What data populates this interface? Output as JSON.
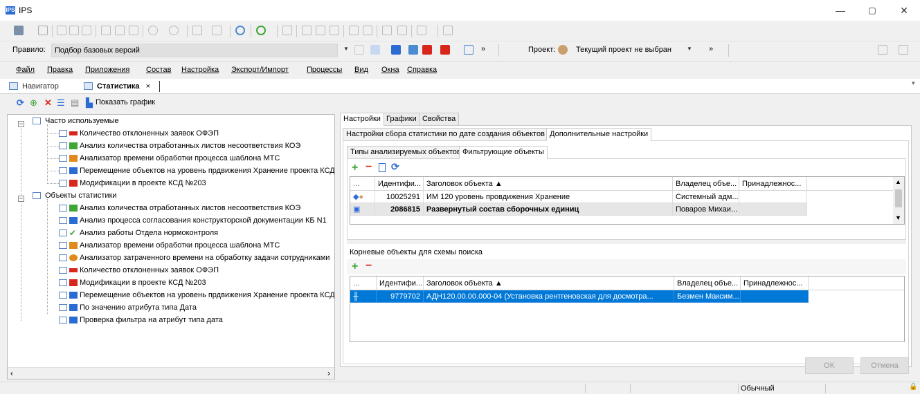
{
  "window": {
    "title": "IPS",
    "app_icon": "IPS",
    "minimize": "—",
    "maximize": "▢",
    "close": "✕"
  },
  "toolbar2": {
    "rule_label": "Правило:",
    "rule_value": "Подбор базовых версий",
    "project_label": "Проект:",
    "project_value": "Текущий проект не выбран"
  },
  "menu": [
    "Файл",
    "Правка",
    "Приложения",
    "Состав",
    "Настройка",
    "Экспорт/Импорт",
    "Процессы",
    "Вид",
    "Окна",
    "Справка"
  ],
  "doc_tabs": {
    "navigator": "Навигатор",
    "statistics": "Статистика",
    "close": "×"
  },
  "graph_toolbar": {
    "show_chart": "Показать график"
  },
  "tree": {
    "group1": "Часто используемые",
    "group1_items": [
      "Количество отклоненных заявок ОФЭП",
      "Анализ количества отработанных листов несоответствия КОЭ",
      "Анализатор времени обработки процесса шаблона МТС",
      "Перемещение объектов  на уровень прдвижения Хранение  проекта  КСД №203",
      "Модификации в проекте КСД №203"
    ],
    "group2": "Объекты статистики",
    "group2_items": [
      "Анализ количества отработанных листов несоответствия КОЭ",
      "Анализ процесса согласования конструкторской документации КБ N1",
      "Анализ работы Отдела нормоконтроля",
      "Анализатор времени обработки процесса шаблона МТС",
      "Анализатор затраченного времени на обработку задачи сотрудниками",
      "Количество отклоненных заявок ОФЭП",
      "Модификации в проекте КСД №203",
      "Перемещение объектов  на уровень прдвижения Хранение  проекта  КСД №203",
      "По значению атрибута типа Дата",
      "Проверка фильтра на атрибут типа дата"
    ]
  },
  "right": {
    "tabs_top": [
      "Настройки",
      "Графики",
      "Свойства"
    ],
    "tabs_mid": [
      "Настройки сбора статистики по дате создания объектов",
      "Дополнительные настройки"
    ],
    "tabs_inner": [
      "Типы анализируемых объектов",
      "Фильтрующие объекты"
    ],
    "grid1": {
      "headers": [
        "...",
        "Идентифи...",
        "Заголовок объекта ▲",
        "Владелец объе...",
        "Принадлежнос..."
      ],
      "rows": [
        {
          "id": "10025291",
          "title": "ИМ 120 уровень провдижения Хранение",
          "owner": "Системный адм...",
          "belongs": ""
        },
        {
          "id": "2086815",
          "title": "Развернутый состав сборочных единиц",
          "owner": "Поваров Михаи...",
          "belongs": ""
        }
      ]
    },
    "root_label": "Корневые объекты для схемы поиска",
    "grid2": {
      "headers": [
        "...",
        "Идентифи...",
        "Заголовок объекта ▲",
        "Владелец объе...",
        "Принадлежнос..."
      ],
      "rows": [
        {
          "id": "9779702",
          "title": "АДН120.00.00.000-04 (Установка рентгеновская для досмотра...",
          "owner": "Безмен Максим...",
          "belongs": ""
        }
      ]
    },
    "ok": "OK",
    "cancel": "Отмена"
  },
  "status": {
    "mode": "Обычный"
  },
  "colors": {
    "selection": "#0078d7",
    "accent_red": "#d9261c",
    "accent_green": "#3fa535"
  }
}
